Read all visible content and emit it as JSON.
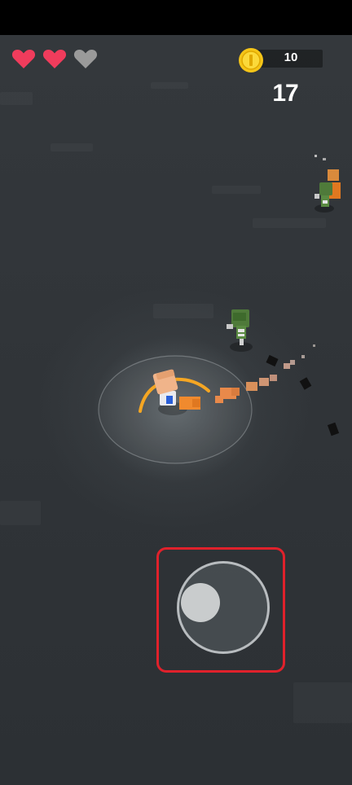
{
  "hud": {
    "lives": {
      "current": 2,
      "max": 3
    },
    "coins": "10",
    "score": "17"
  },
  "icons": {
    "heart_full": "heart-icon",
    "heart_empty": "heart-empty-icon",
    "coin": "coin-icon"
  },
  "colors": {
    "heart_full": "#f03c5c",
    "heart_empty": "#9a9a9a",
    "coin": "#f5c518",
    "joystick_highlight": "#e0212b",
    "attack_arc": "#f5a623"
  }
}
